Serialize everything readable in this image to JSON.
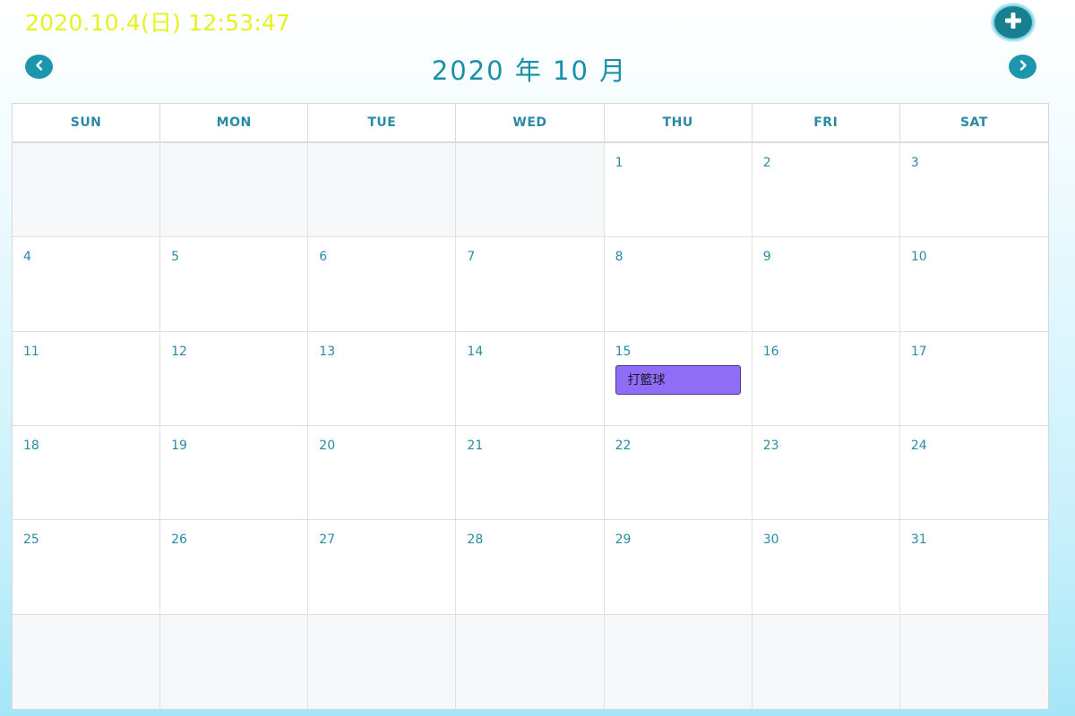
{
  "header": {
    "clock_text": "2020.10.4(日) 12:53:47",
    "month_title": "2020 年 10 月",
    "add_icon": "plus-icon",
    "prev_icon": "chevron-left-icon",
    "next_icon": "chevron-right-icon"
  },
  "weekdays": [
    "SUN",
    "MON",
    "TUE",
    "WED",
    "THU",
    "FRI",
    "SAT"
  ],
  "days": [
    "",
    "",
    "",
    "",
    "1",
    "2",
    "3",
    "4",
    "5",
    "6",
    "7",
    "8",
    "9",
    "10",
    "11",
    "12",
    "13",
    "14",
    "15",
    "16",
    "17",
    "18",
    "19",
    "20",
    "21",
    "22",
    "23",
    "24",
    "25",
    "26",
    "27",
    "28",
    "29",
    "30",
    "31",
    "",
    "",
    "",
    "",
    "",
    "",
    ""
  ],
  "events": [
    {
      "day": "15",
      "title": "打籃球"
    }
  ],
  "colors": {
    "accent": "#1b8fa6",
    "clock": "#e6f21e",
    "event_bg": "#8f6df7",
    "add_button": "#177f90"
  }
}
